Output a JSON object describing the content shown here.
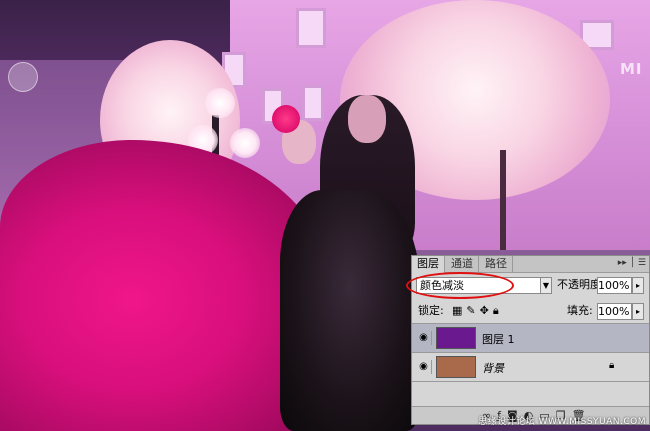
{
  "photo": {
    "sign_text": "MI"
  },
  "layers_panel": {
    "tabs": [
      {
        "label": "图层",
        "active": true
      },
      {
        "label": "通道",
        "active": false
      },
      {
        "label": "路径",
        "active": false
      }
    ],
    "blend_mode": "颜色减淡",
    "opacity_label": "不透明度:",
    "opacity_value": "100%",
    "lock_label": "锁定:",
    "fill_label": "填充:",
    "fill_value": "100%",
    "layers": [
      {
        "name": "图层 1",
        "thumb_color": "#6a1a8e",
        "selected": true,
        "locked": false
      },
      {
        "name": "背景",
        "thumb_color": "#a86a4a",
        "selected": false,
        "locked": true
      }
    ],
    "icons": {
      "eye": "eye-icon",
      "lock": "lock-icon",
      "link": "link-icon",
      "fx": "fx-icon",
      "mask": "mask-icon",
      "adjustment": "adjustment-icon",
      "folder": "folder-icon",
      "new_layer": "new-layer-icon",
      "trash": "trash-icon"
    }
  },
  "watermark": "思缘设计论坛 WWW.MISSYUAN.COM",
  "colors": {
    "ellipse_highlight": "#e01010",
    "selected_layer": "#b4b6c4"
  }
}
